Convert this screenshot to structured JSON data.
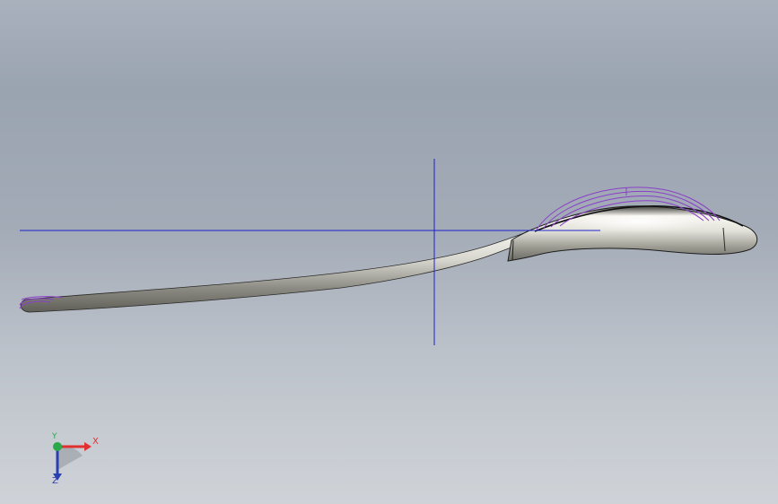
{
  "viewport": {
    "name": "3D model view",
    "background_top": "#9aa3b0",
    "background_bottom": "#cfd3d8"
  },
  "model": {
    "object": "spoon",
    "body_color": "#c9c8bf",
    "edge_color": "#1e1e1e"
  },
  "sketch": {
    "reference_line_color": "#1e22c8",
    "profile_color": "#8a3fc9"
  },
  "triad": {
    "x_label": "X",
    "y_label": "Y",
    "z_label": "Z",
    "x_color": "#e03030",
    "y_color": "#2aa84a",
    "z_color": "#2a3fb0"
  }
}
